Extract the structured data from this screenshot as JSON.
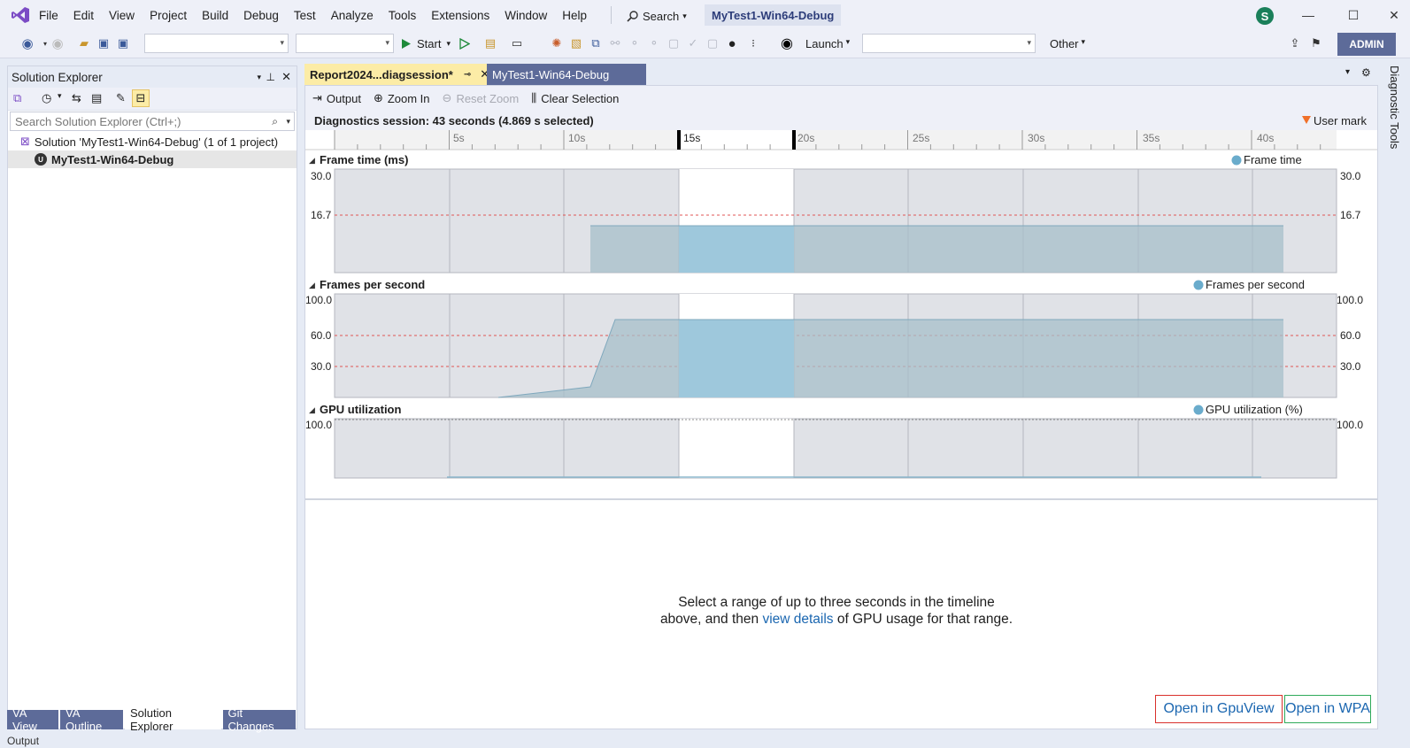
{
  "menu": [
    "File",
    "Edit",
    "View",
    "Project",
    "Build",
    "Debug",
    "Test",
    "Analyze",
    "Tools",
    "Extensions",
    "Window",
    "Help"
  ],
  "search_label": "Search",
  "project_title": "MyTest1-Win64-Debug",
  "avatar_initial": "S",
  "toolbar": {
    "start_label": "Start",
    "launch_label": "Launch",
    "other_label": "Other",
    "admin_label": "ADMIN"
  },
  "solution_explorer": {
    "title": "Solution Explorer",
    "search_placeholder": "Search Solution Explorer (Ctrl+;)",
    "solution_label": "Solution 'MyTest1-Win64-Debug' (1 of 1 project)",
    "project_label": "MyTest1-Win64-Debug"
  },
  "bottom_tabs": [
    "VA View",
    "VA Outline",
    "Solution Explorer",
    "Git Changes"
  ],
  "status_text": "Output",
  "doc_tabs": {
    "active": "Report2024...diagsession*",
    "inactive": "MyTest1-Win64-Debug"
  },
  "doc_toolbar": {
    "output": "Output",
    "zoom_in": "Zoom In",
    "reset_zoom": "Reset Zoom",
    "clear_selection": "Clear Selection"
  },
  "session_text": "Diagnostics session: 43 seconds (4.869 s selected)",
  "user_mark": "User mark",
  "ruler_ticks": [
    "5s",
    "10s",
    "15s",
    "20s",
    "25s",
    "30s",
    "35s",
    "40s"
  ],
  "graphs": {
    "frame_time": {
      "title": "Frame time (ms)",
      "legend": "Frame time",
      "ticks": [
        "30.0",
        "16.7"
      ]
    },
    "fps": {
      "title": "Frames per second",
      "legend": "Frames per second",
      "ticks": [
        "100.0",
        "60.0",
        "30.0"
      ]
    },
    "gpu": {
      "title": "GPU utilization",
      "legend": "GPU utilization (%)",
      "ticks": [
        "100.0"
      ]
    }
  },
  "message": {
    "part1": "Select a range of up to three seconds in the timeline above, and then ",
    "link": "view details",
    "part2": " of GPU usage for that range."
  },
  "buttons": {
    "gpuview": "Open in GpuView",
    "wpa": "Open in WPA"
  },
  "right_rail_label": "Diagnostic Tools",
  "colors": {
    "accent": "#5d6b99",
    "series": "#6aaccc",
    "selected_fill": "#9ec8dc",
    "link": "#1a66b0"
  }
}
